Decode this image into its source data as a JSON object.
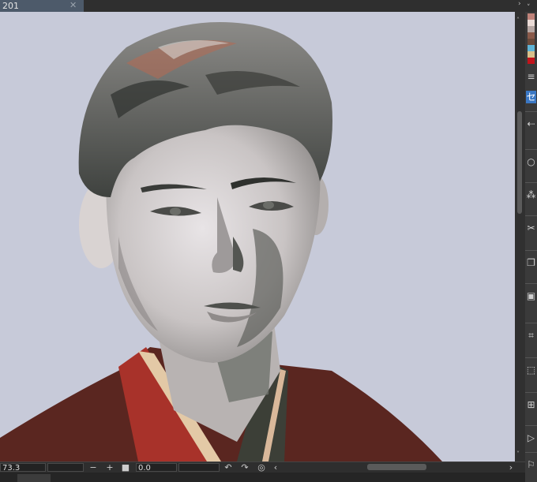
{
  "document": {
    "tab_title": "201",
    "close_glyph": "✕"
  },
  "tab_controls": {
    "right_chevron": "›",
    "down_chevron": "˅"
  },
  "palette": {
    "swatches": [
      "#c0837a",
      "#eadbd6",
      "#b6a7a3",
      "#8a5a4a",
      "#6b4a3a",
      "#5fb4d6",
      "#d8c08a",
      "#c2141b"
    ]
  },
  "toolbar": {
    "tools": [
      {
        "name": "menu-icon",
        "glyph": "≡"
      },
      {
        "name": "selection-tab-icon",
        "glyph": "セ"
      },
      {
        "name": "move-arrow-icon",
        "glyph": "⇠"
      },
      {
        "name": "lasso-icon",
        "glyph": "○"
      },
      {
        "name": "sparkle-icon",
        "glyph": "⁂"
      },
      {
        "name": "scissors-icon",
        "glyph": "✂"
      },
      {
        "name": "copy-icon",
        "glyph": "❐"
      },
      {
        "name": "paste-icon",
        "glyph": "▣"
      },
      {
        "name": "transform-icon",
        "glyph": "⌗"
      },
      {
        "name": "scale-icon",
        "glyph": "⬚"
      },
      {
        "name": "grid-icon",
        "glyph": "⊞"
      },
      {
        "name": "play-icon",
        "glyph": "▷"
      },
      {
        "name": "flag-icon",
        "glyph": "⚐"
      }
    ]
  },
  "statusbar": {
    "zoom_value": "73.3",
    "zoom_out": "−",
    "zoom_in": "+",
    "fit": "■",
    "angle_value": "0.0",
    "rotate_left": "↶",
    "rotate_right": "↷",
    "reset_rotation": "◎",
    "scroll_left": "‹",
    "scroll_right": "›"
  },
  "scroll": {
    "up": "˄",
    "down": "˅"
  }
}
